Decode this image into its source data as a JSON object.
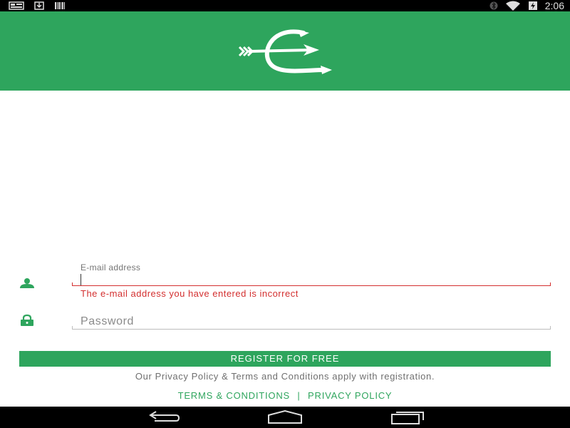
{
  "status_bar": {
    "time": "2:06",
    "left_icons": [
      "notification-card-icon",
      "download-icon",
      "barcode-icon"
    ],
    "right_icons": [
      "bluetooth-icon",
      "wifi-icon",
      "battery-icon"
    ]
  },
  "header": {
    "logo_icon": "arrow-logo-icon",
    "background": "#2ea55d"
  },
  "email": {
    "label": "E-mail address",
    "value": "",
    "error": "The e-mail address you have entered is incorrect",
    "icon": "person-icon"
  },
  "password": {
    "placeholder": "Password",
    "icon": "lock-icon"
  },
  "register": {
    "label": "REGISTER FOR FREE"
  },
  "legal": {
    "note": "Our Privacy Policy & Terms and Conditions apply with registration.",
    "terms_label": "TERMS & CONDITIONS",
    "separator": "|",
    "privacy_label": "PRIVACY POLICY"
  },
  "nav_bar": {
    "buttons": [
      "back-icon",
      "home-icon",
      "recents-icon"
    ]
  },
  "colors": {
    "brand": "#2ea55d",
    "error": "#d32f2f"
  }
}
